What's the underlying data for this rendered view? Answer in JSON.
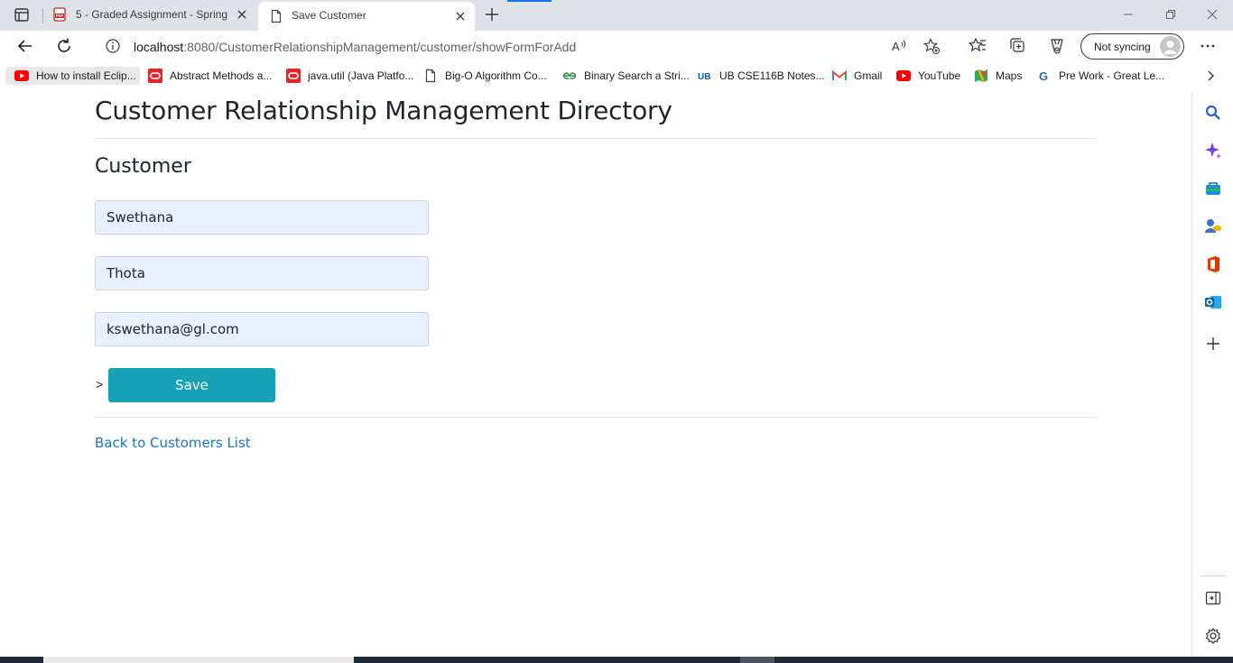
{
  "browser": {
    "tabs": [
      {
        "title": "5 - Graded Assignment - Spring",
        "icon": "pdf-icon"
      },
      {
        "title": "Save Customer",
        "icon": "page-icon"
      }
    ],
    "address": {
      "host": "localhost",
      "path": ":8080/CustomerRelationshipManagement/customer/showFormForAdd"
    },
    "sync_label": "Not syncing",
    "bookmarks": [
      {
        "label": "How to install Eclip...",
        "icon": "youtube-icon"
      },
      {
        "label": "Abstract Methods a...",
        "icon": "oracle-icon"
      },
      {
        "label": "java.util (Java Platfo...",
        "icon": "oracle-icon"
      },
      {
        "label": "Big-O Algorithm Co...",
        "icon": "page-icon"
      },
      {
        "label": "Binary Search a Stri...",
        "icon": "geeksforgeeks-icon"
      },
      {
        "label": "UB CSE116B Notes...",
        "icon": "ub-icon"
      },
      {
        "label": "Gmail",
        "icon": "gmail-icon"
      },
      {
        "label": "YouTube",
        "icon": "youtube-icon"
      },
      {
        "label": "Maps",
        "icon": "maps-icon"
      },
      {
        "label": "Pre Work - Great Le...",
        "icon": "greatlearning-icon"
      }
    ]
  },
  "page": {
    "heading": "Customer Relationship Management Directory",
    "subheading": "Customer",
    "form": {
      "first_name": "Swethana",
      "last_name": "Thota",
      "email": "kswethana@gl.com",
      "stray_text": ">",
      "save_label": "Save"
    },
    "back_link": "Back to Customers List"
  },
  "colors": {
    "save_button": "#17a2b8",
    "input_autofill": "#e8f0fe",
    "link": "#1a73c9"
  }
}
